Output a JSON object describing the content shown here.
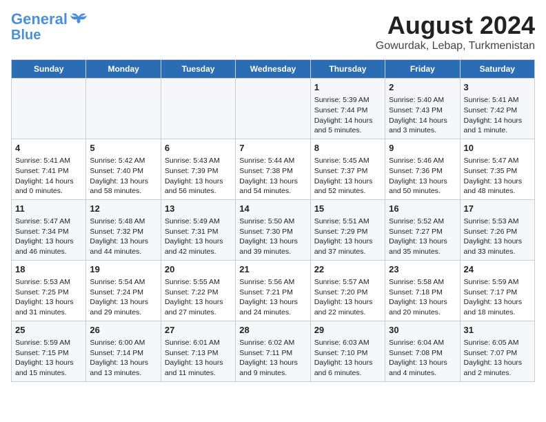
{
  "logo": {
    "line1": "General",
    "line2": "Blue"
  },
  "title": "August 2024",
  "subtitle": "Gowurdak, Lebap, Turkmenistan",
  "days_header": [
    "Sunday",
    "Monday",
    "Tuesday",
    "Wednesday",
    "Thursday",
    "Friday",
    "Saturday"
  ],
  "weeks": [
    [
      {
        "day": "",
        "info": ""
      },
      {
        "day": "",
        "info": ""
      },
      {
        "day": "",
        "info": ""
      },
      {
        "day": "",
        "info": ""
      },
      {
        "day": "1",
        "info": "Sunrise: 5:39 AM\nSunset: 7:44 PM\nDaylight: 14 hours\nand 5 minutes."
      },
      {
        "day": "2",
        "info": "Sunrise: 5:40 AM\nSunset: 7:43 PM\nDaylight: 14 hours\nand 3 minutes."
      },
      {
        "day": "3",
        "info": "Sunrise: 5:41 AM\nSunset: 7:42 PM\nDaylight: 14 hours\nand 1 minute."
      }
    ],
    [
      {
        "day": "4",
        "info": "Sunrise: 5:41 AM\nSunset: 7:41 PM\nDaylight: 14 hours\nand 0 minutes."
      },
      {
        "day": "5",
        "info": "Sunrise: 5:42 AM\nSunset: 7:40 PM\nDaylight: 13 hours\nand 58 minutes."
      },
      {
        "day": "6",
        "info": "Sunrise: 5:43 AM\nSunset: 7:39 PM\nDaylight: 13 hours\nand 56 minutes."
      },
      {
        "day": "7",
        "info": "Sunrise: 5:44 AM\nSunset: 7:38 PM\nDaylight: 13 hours\nand 54 minutes."
      },
      {
        "day": "8",
        "info": "Sunrise: 5:45 AM\nSunset: 7:37 PM\nDaylight: 13 hours\nand 52 minutes."
      },
      {
        "day": "9",
        "info": "Sunrise: 5:46 AM\nSunset: 7:36 PM\nDaylight: 13 hours\nand 50 minutes."
      },
      {
        "day": "10",
        "info": "Sunrise: 5:47 AM\nSunset: 7:35 PM\nDaylight: 13 hours\nand 48 minutes."
      }
    ],
    [
      {
        "day": "11",
        "info": "Sunrise: 5:47 AM\nSunset: 7:34 PM\nDaylight: 13 hours\nand 46 minutes."
      },
      {
        "day": "12",
        "info": "Sunrise: 5:48 AM\nSunset: 7:32 PM\nDaylight: 13 hours\nand 44 minutes."
      },
      {
        "day": "13",
        "info": "Sunrise: 5:49 AM\nSunset: 7:31 PM\nDaylight: 13 hours\nand 42 minutes."
      },
      {
        "day": "14",
        "info": "Sunrise: 5:50 AM\nSunset: 7:30 PM\nDaylight: 13 hours\nand 39 minutes."
      },
      {
        "day": "15",
        "info": "Sunrise: 5:51 AM\nSunset: 7:29 PM\nDaylight: 13 hours\nand 37 minutes."
      },
      {
        "day": "16",
        "info": "Sunrise: 5:52 AM\nSunset: 7:27 PM\nDaylight: 13 hours\nand 35 minutes."
      },
      {
        "day": "17",
        "info": "Sunrise: 5:53 AM\nSunset: 7:26 PM\nDaylight: 13 hours\nand 33 minutes."
      }
    ],
    [
      {
        "day": "18",
        "info": "Sunrise: 5:53 AM\nSunset: 7:25 PM\nDaylight: 13 hours\nand 31 minutes."
      },
      {
        "day": "19",
        "info": "Sunrise: 5:54 AM\nSunset: 7:24 PM\nDaylight: 13 hours\nand 29 minutes."
      },
      {
        "day": "20",
        "info": "Sunrise: 5:55 AM\nSunset: 7:22 PM\nDaylight: 13 hours\nand 27 minutes."
      },
      {
        "day": "21",
        "info": "Sunrise: 5:56 AM\nSunset: 7:21 PM\nDaylight: 13 hours\nand 24 minutes."
      },
      {
        "day": "22",
        "info": "Sunrise: 5:57 AM\nSunset: 7:20 PM\nDaylight: 13 hours\nand 22 minutes."
      },
      {
        "day": "23",
        "info": "Sunrise: 5:58 AM\nSunset: 7:18 PM\nDaylight: 13 hours\nand 20 minutes."
      },
      {
        "day": "24",
        "info": "Sunrise: 5:59 AM\nSunset: 7:17 PM\nDaylight: 13 hours\nand 18 minutes."
      }
    ],
    [
      {
        "day": "25",
        "info": "Sunrise: 5:59 AM\nSunset: 7:15 PM\nDaylight: 13 hours\nand 15 minutes."
      },
      {
        "day": "26",
        "info": "Sunrise: 6:00 AM\nSunset: 7:14 PM\nDaylight: 13 hours\nand 13 minutes."
      },
      {
        "day": "27",
        "info": "Sunrise: 6:01 AM\nSunset: 7:13 PM\nDaylight: 13 hours\nand 11 minutes."
      },
      {
        "day": "28",
        "info": "Sunrise: 6:02 AM\nSunset: 7:11 PM\nDaylight: 13 hours\nand 9 minutes."
      },
      {
        "day": "29",
        "info": "Sunrise: 6:03 AM\nSunset: 7:10 PM\nDaylight: 13 hours\nand 6 minutes."
      },
      {
        "day": "30",
        "info": "Sunrise: 6:04 AM\nSunset: 7:08 PM\nDaylight: 13 hours\nand 4 minutes."
      },
      {
        "day": "31",
        "info": "Sunrise: 6:05 AM\nSunset: 7:07 PM\nDaylight: 13 hours\nand 2 minutes."
      }
    ]
  ]
}
